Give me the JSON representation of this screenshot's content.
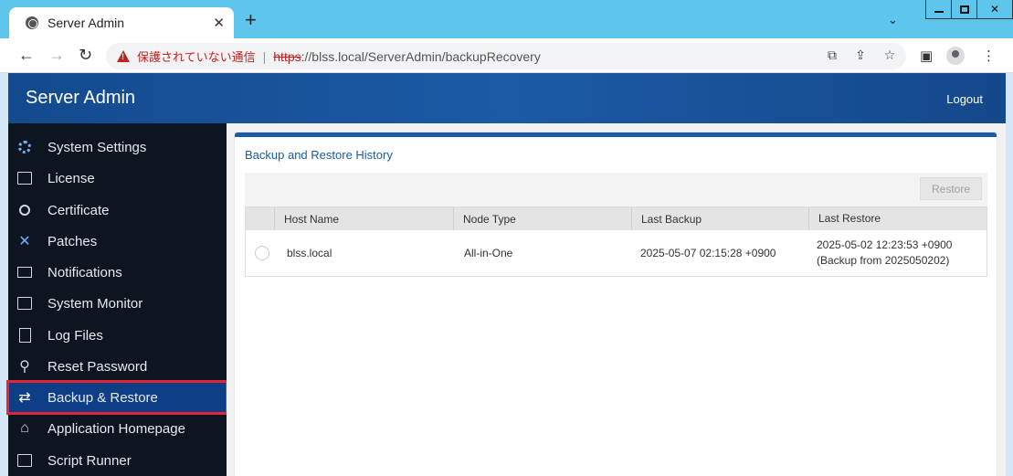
{
  "browser": {
    "tab_title": "Server Admin",
    "tab_close": "✕",
    "new_tab": "+",
    "tab_search": "⌄",
    "not_secure_label": "保護されていない通信",
    "url_scheme": "https",
    "url_rest": "://blss.local/ServerAdmin/backupRecovery",
    "nav": {
      "back": "←",
      "forward": "→",
      "reload": "↻"
    },
    "window_close": "✕",
    "toolbar_icons": {
      "translate": "⧉",
      "share": "⇪",
      "star": "☆",
      "sidepanel": "▣",
      "menu": "⋮"
    }
  },
  "header": {
    "title": "Server Admin",
    "logout": "Logout"
  },
  "sidebar": {
    "items": [
      {
        "label": "System Settings",
        "icon": "settings-icon"
      },
      {
        "label": "License",
        "icon": "license-icon"
      },
      {
        "label": "Certificate",
        "icon": "certificate-icon"
      },
      {
        "label": "Patches",
        "icon": "patches-icon"
      },
      {
        "label": "Notifications",
        "icon": "notifications-icon"
      },
      {
        "label": "System Monitor",
        "icon": "monitor-icon"
      },
      {
        "label": "Log Files",
        "icon": "log-files-icon"
      },
      {
        "label": "Reset Password",
        "icon": "reset-password-icon"
      },
      {
        "label": "Backup & Restore",
        "icon": "backup-restore-icon",
        "active": true
      },
      {
        "label": "Application Homepage",
        "icon": "home-icon"
      },
      {
        "label": "Script Runner",
        "icon": "terminal-icon"
      }
    ]
  },
  "main": {
    "panel_title": "Backup and Restore History",
    "restore_button": "Restore",
    "table": {
      "columns": [
        "Host Name",
        "Node Type",
        "Last Backup",
        "Last Restore"
      ],
      "rows": [
        {
          "host_name": "blss.local",
          "node_type": "All-in-One",
          "last_backup": "2025-05-07 02:15:28 +0900",
          "last_restore": "2025-05-02 12:23:53 +0900 (Backup from 2025050202)"
        }
      ]
    }
  },
  "colors": {
    "accent": "#1c5aa6",
    "sidebar_bg": "#0d1520",
    "active_item": "#0e3f86",
    "highlight_outline": "#e32636",
    "browser_frame": "#5ec5ec"
  }
}
